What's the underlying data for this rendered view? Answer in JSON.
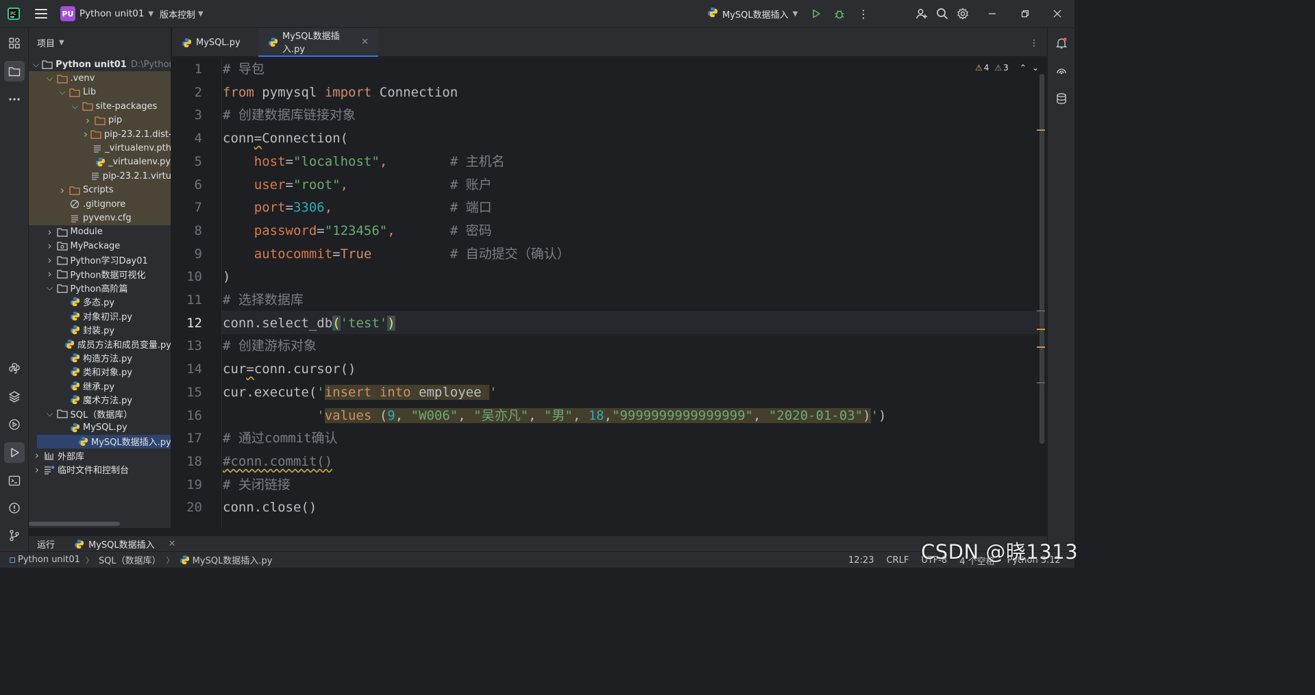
{
  "topbar": {
    "project_badge": "PU",
    "project_name": "Python unit01",
    "vcs_label": "版本控制",
    "run_config": "MySQL数据插入"
  },
  "project_panel": {
    "title": "项目",
    "tree": [
      {
        "label": "Python unit01",
        "hint": "D:\\Python C",
        "depth": 0,
        "twisty": "open",
        "icon": "folder-icon",
        "bold": true
      },
      {
        "label": ".venv",
        "depth": 1,
        "twisty": "open",
        "icon": "folder-excluded-icon",
        "venv": true
      },
      {
        "label": "Lib",
        "depth": 2,
        "twisty": "open",
        "icon": "folder-excluded-icon",
        "venv": true
      },
      {
        "label": "site-packages",
        "depth": 3,
        "twisty": "open",
        "icon": "folder-excluded-icon",
        "venv": true
      },
      {
        "label": "pip",
        "depth": 4,
        "twisty": "closed",
        "icon": "folder-excluded-icon",
        "venv": true
      },
      {
        "label": "pip-23.2.1.dist-",
        "depth": 4,
        "twisty": "closed",
        "icon": "folder-excluded-icon",
        "venv": true
      },
      {
        "label": "_virtualenv.pth",
        "depth": 4,
        "twisty": "none",
        "icon": "text-file-icon",
        "venv": true
      },
      {
        "label": "_virtualenv.py",
        "depth": 4,
        "twisty": "none",
        "icon": "python-file-icon",
        "venv": true
      },
      {
        "label": "pip-23.2.1.virtu",
        "depth": 4,
        "twisty": "none",
        "icon": "text-file-icon",
        "venv": true
      },
      {
        "label": "Scripts",
        "depth": 2,
        "twisty": "closed",
        "icon": "folder-excluded-icon",
        "venv": true
      },
      {
        "label": ".gitignore",
        "depth": 2,
        "twisty": "none",
        "icon": "ignore-file-icon",
        "venv": true
      },
      {
        "label": "pyvenv.cfg",
        "depth": 2,
        "twisty": "none",
        "icon": "text-file-icon",
        "venv": true
      },
      {
        "label": "Module",
        "depth": 1,
        "twisty": "closed",
        "icon": "folder-icon"
      },
      {
        "label": "MyPackage",
        "depth": 1,
        "twisty": "closed",
        "icon": "package-icon"
      },
      {
        "label": "Python学习Day01",
        "depth": 1,
        "twisty": "closed",
        "icon": "folder-icon"
      },
      {
        "label": "Python数据可视化",
        "depth": 1,
        "twisty": "closed",
        "icon": "folder-icon"
      },
      {
        "label": "Python高阶篇",
        "depth": 1,
        "twisty": "open",
        "icon": "folder-icon"
      },
      {
        "label": "多态.py",
        "depth": 2,
        "twisty": "none",
        "icon": "python-file-icon"
      },
      {
        "label": "对象初识.py",
        "depth": 2,
        "twisty": "none",
        "icon": "python-file-icon"
      },
      {
        "label": "封装.py",
        "depth": 2,
        "twisty": "none",
        "icon": "python-file-icon"
      },
      {
        "label": "成员方法和成员变量.py",
        "depth": 2,
        "twisty": "none",
        "icon": "python-file-icon"
      },
      {
        "label": "构造方法.py",
        "depth": 2,
        "twisty": "none",
        "icon": "python-file-icon"
      },
      {
        "label": "类和对象.py",
        "depth": 2,
        "twisty": "none",
        "icon": "python-file-icon"
      },
      {
        "label": "继承.py",
        "depth": 2,
        "twisty": "none",
        "icon": "python-file-icon"
      },
      {
        "label": "魔术方法.py",
        "depth": 2,
        "twisty": "none",
        "icon": "python-file-icon"
      },
      {
        "label": "SQL（数据库）",
        "depth": 1,
        "twisty": "open",
        "icon": "folder-icon"
      },
      {
        "label": "MySQL.py",
        "depth": 2,
        "twisty": "none",
        "icon": "python-file-icon"
      },
      {
        "label": "MySQL数据插入.py",
        "depth": 2,
        "twisty": "none",
        "icon": "python-file-icon",
        "selected": true
      },
      {
        "label": "外部库",
        "depth": 0,
        "twisty": "closed",
        "icon": "library-icon"
      },
      {
        "label": "临时文件和控制台",
        "depth": 0,
        "twisty": "closed",
        "icon": "scratches-icon"
      }
    ]
  },
  "editor": {
    "tabs": [
      {
        "label": "MySQL.py",
        "active": false
      },
      {
        "label": "MySQL数据插入.py",
        "active": true
      }
    ],
    "warnings_count": "4",
    "weak_warnings_count": "3",
    "current_line": 12,
    "lines": [
      [
        [
          "cmt",
          "# 导包"
        ]
      ],
      [
        [
          "kw",
          "from"
        ],
        [
          "",
          " pymysql "
        ],
        [
          "kw",
          "import"
        ],
        [
          "",
          " Connection"
        ]
      ],
      [
        [
          "cmt",
          "# 创建数据库链接对象"
        ]
      ],
      [
        [
          "squig-pre",
          "conn"
        ],
        [
          "squig",
          "="
        ],
        [
          "",
          "Connection("
        ]
      ],
      [
        [
          "",
          "    "
        ],
        [
          "param",
          "host"
        ],
        [
          "",
          "="
        ],
        [
          "str",
          "\"localhost\""
        ],
        [
          "kw",
          ","
        ],
        [
          "",
          "        "
        ],
        [
          "cmt",
          "# 主机名"
        ]
      ],
      [
        [
          "",
          "    "
        ],
        [
          "param",
          "user"
        ],
        [
          "",
          "="
        ],
        [
          "str",
          "\"root\""
        ],
        [
          "kw",
          ","
        ],
        [
          "",
          "             "
        ],
        [
          "cmt",
          "# 账户"
        ]
      ],
      [
        [
          "",
          "    "
        ],
        [
          "param",
          "port"
        ],
        [
          "",
          "="
        ],
        [
          "num",
          "3306"
        ],
        [
          "kw",
          ","
        ],
        [
          "",
          "               "
        ],
        [
          "cmt",
          "# 端口"
        ]
      ],
      [
        [
          "",
          "    "
        ],
        [
          "param",
          "password"
        ],
        [
          "",
          "="
        ],
        [
          "str",
          "\"123456\""
        ],
        [
          "kw",
          ","
        ],
        [
          "",
          "       "
        ],
        [
          "cmt",
          "# 密码"
        ]
      ],
      [
        [
          "",
          "    "
        ],
        [
          "param",
          "autocommit"
        ],
        [
          "",
          "="
        ],
        [
          "kw",
          "True"
        ],
        [
          "",
          "          "
        ],
        [
          "cmt",
          "# 自动提交（确认）"
        ]
      ],
      [
        [
          "",
          ")"
        ]
      ],
      [
        [
          "cmt",
          "# 选择数据库"
        ]
      ],
      [
        [
          "",
          "conn.select_db"
        ],
        [
          "paren-hl",
          "("
        ],
        [
          "str",
          "'test'"
        ],
        [
          "paren-hl",
          ")"
        ]
      ],
      [
        [
          "cmt",
          "# 创建游标对象"
        ]
      ],
      [
        [
          "squig-pre",
          "cur"
        ],
        [
          "squig",
          "="
        ],
        [
          "",
          "conn.cursor()"
        ]
      ],
      [
        [
          "",
          "cur.execute("
        ],
        [
          "str",
          "'"
        ],
        [
          "sql-kw",
          "insert into"
        ],
        [
          "sql",
          " employee "
        ],
        [
          "str",
          "'"
        ]
      ],
      [
        [
          "",
          "            "
        ],
        [
          "str",
          "'"
        ],
        [
          "sql-kw",
          "values"
        ],
        [
          "sql",
          " ("
        ],
        [
          "sql-num",
          "9"
        ],
        [
          "sql",
          ", "
        ],
        [
          "sql-str",
          "\"W006\""
        ],
        [
          "sql",
          ", "
        ],
        [
          "sql-str",
          "\"吴亦凡\""
        ],
        [
          "sql",
          ", "
        ],
        [
          "sql-str",
          "\"男\""
        ],
        [
          "sql",
          ", "
        ],
        [
          "sql-num",
          "18"
        ],
        [
          "sql",
          ","
        ],
        [
          "sql-str",
          "\"9999999999999999\""
        ],
        [
          "sql",
          ", "
        ],
        [
          "sql-str",
          "\"2020-01-03\""
        ],
        [
          "sql",
          ")"
        ],
        [
          "str",
          "'"
        ],
        [
          "",
          ")"
        ]
      ],
      [
        [
          "cmt",
          "# 通过commit确认"
        ]
      ],
      [
        [
          "cmt-squig",
          "#conn.commit()"
        ]
      ],
      [
        [
          "cmt",
          "# 关闭链接"
        ]
      ],
      [
        [
          "",
          "conn.close()"
        ]
      ]
    ]
  },
  "run_window": {
    "label": "运行",
    "tab": "MySQL数据插入"
  },
  "status_bar": {
    "breadcrumbs": [
      "Python unit01",
      "SQL（数据库）",
      "MySQL数据插入.py"
    ],
    "position": "12:23",
    "line_sep": "CRLF",
    "encoding": "UTF-8",
    "indent": "4 个空格",
    "interpreter": "Python 3.12"
  },
  "watermark": "CSDN @晓1313",
  "colors": {
    "accent": "#3574f0",
    "run_green": "#5fb865",
    "warning_yellow": "#e6b450"
  }
}
